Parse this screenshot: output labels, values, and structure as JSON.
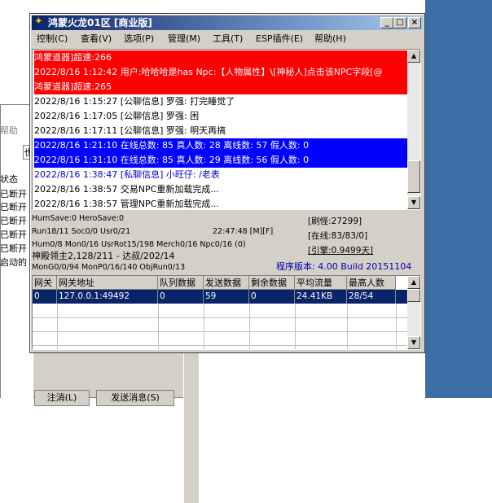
{
  "background_window": {
    "tab_labels": [
      "帮助",
      "也"
    ],
    "header": "状态",
    "rows": [
      "已断开",
      "已断开",
      "已断开",
      "已断开",
      "已断开",
      "启动的"
    ],
    "buttons": [
      "注消(L)",
      "发送消息(S)"
    ]
  },
  "window": {
    "title": "鸿蒙火龙01区 [商业版]",
    "controls": [
      "_",
      "□",
      "×"
    ]
  },
  "menu": [
    "控制(C)",
    "查看(V)",
    "选项(P)",
    "管理(M)",
    "工具(T)",
    "ESP插件(E)",
    "帮助(H)"
  ],
  "log_lines": [
    {
      "text": "鸿蒙道器]超速:266",
      "style": "red"
    },
    {
      "text": "2022/8/16 1:12:42 用户:哈哈哈是has Npc:【人物属性】\\[神秘人]点击该NPC字段[@",
      "style": "red"
    },
    {
      "text": "鸿蒙道器]超速:265",
      "style": "red"
    },
    {
      "text": "2022/8/16 1:15:27 [公聊信息] 罗强: 打完睡觉了",
      "style": "normal"
    },
    {
      "text": "2022/8/16 1:17:05 [公聊信息] 罗强: 困",
      "style": "normal"
    },
    {
      "text": "2022/8/16 1:17:11 [公聊信息] 罗强: 明天再搞",
      "style": "normal"
    },
    {
      "text": "2022/8/16 1:21:10 在线总数: 85 真人数: 28 离线数: 57 假人数: 0",
      "style": "blue"
    },
    {
      "text": "2022/8/16 1:31:10 在线总数: 85 真人数: 29 离线数: 56 假人数: 0",
      "style": "blue"
    },
    {
      "text": "2022/8/16 1:38:47 [私聊信息] 小旺仔: /老表",
      "style": "pm"
    },
    {
      "text": "2022/8/16 1:38:57 交易NPC重新加载完成...",
      "style": "normal"
    },
    {
      "text": "2022/8/16 1:38:57 管理NPC重新加载完成...",
      "style": "normal"
    },
    {
      "text": "|",
      "style": "normal"
    }
  ],
  "status": {
    "line1": "HumSave:0 HeroSave:0",
    "line2": "Run18/11 Soc0/0 Usr0/21",
    "time": "22:47:48 [M][F]",
    "line3": "Hum0/8 Mon0/16 UsrRot15/198 Merch0/16 Npc0/16 (0)",
    "line4": "神殿领主2,128/211 - 达叔/202/14",
    "line5": "MonG0/0/94 MonP0/16/140 ObjRun0/13",
    "refresh": "[刷怪:27299]",
    "online": "[在线:83/83/0]",
    "engine": "[引擎:0.9499天]",
    "version": "程序版本: 4.00 Build 20151104"
  },
  "gateway_table": {
    "headers": [
      "网关",
      "网关地址",
      "队列数据",
      "发送数据",
      "剩余数据",
      "平均流量",
      "最高人数"
    ],
    "rows": [
      [
        "0",
        "127.0.0.1:49492",
        "0",
        "59",
        "0",
        "24.41KB",
        "28/54"
      ]
    ]
  }
}
